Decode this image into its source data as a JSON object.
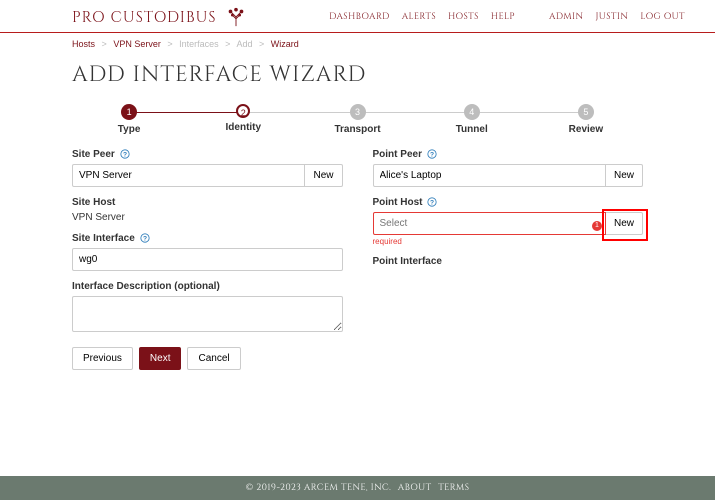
{
  "brand": {
    "name": "PRO CUSTODIBUS"
  },
  "nav": {
    "primary": [
      {
        "label": "DASHBOARD"
      },
      {
        "label": "ALERTS"
      },
      {
        "label": "HOSTS"
      },
      {
        "label": "HELP"
      }
    ],
    "secondary": [
      {
        "label": "ADMIN"
      },
      {
        "label": "JUSTIN"
      },
      {
        "label": "LOG OUT"
      }
    ]
  },
  "breadcrumb": [
    {
      "label": "Hosts",
      "link": true
    },
    {
      "label": "VPN Server",
      "link": true
    },
    {
      "label": "Interfaces",
      "link": false
    },
    {
      "label": "Add",
      "link": false
    },
    {
      "label": "Wizard",
      "current": true
    }
  ],
  "title": "ADD INTERFACE WIZARD",
  "steps": [
    {
      "num": "1",
      "label": "Type",
      "state": "active"
    },
    {
      "num": "2",
      "label": "Identity",
      "state": "current"
    },
    {
      "num": "3",
      "label": "Transport",
      "state": "future"
    },
    {
      "num": "4",
      "label": "Tunnel",
      "state": "future"
    },
    {
      "num": "5",
      "label": "Review",
      "state": "future"
    }
  ],
  "left": {
    "site_peer_label": "Site Peer",
    "site_peer_value": "VPN Server",
    "site_peer_new": "New",
    "site_host_label": "Site Host",
    "site_host_value": "VPN Server",
    "site_interface_label": "Site Interface",
    "site_interface_value": "wg0",
    "desc_label": "Interface Description (optional)",
    "desc_value": ""
  },
  "right": {
    "point_peer_label": "Point Peer",
    "point_peer_value": "Alice's Laptop",
    "point_peer_new": "New",
    "point_host_label": "Point Host",
    "point_host_placeholder": "Select",
    "point_host_new": "New",
    "point_host_error": "required",
    "point_interface_label": "Point Interface"
  },
  "buttons": {
    "previous": "Previous",
    "next": "Next",
    "cancel": "Cancel"
  },
  "footer": {
    "copyright": "© 2019-2023 ARCEM TENE, INC.",
    "about": "ABOUT",
    "terms": "TERMS"
  },
  "annotation": {
    "marker": "1"
  }
}
